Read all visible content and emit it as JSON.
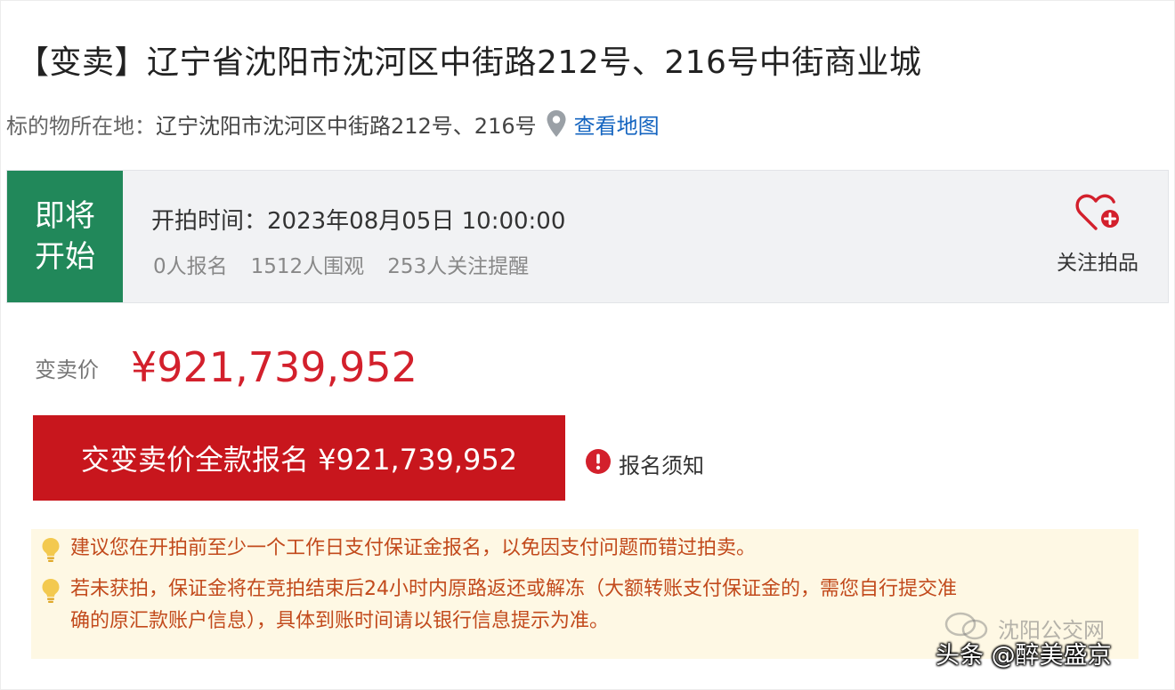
{
  "title": "【变卖】辽宁省沈阳市沈河区中街路212号、216号中街商业城",
  "location": {
    "label": "标的物所在地：",
    "value": "辽宁沈阳市沈河区中街路212号、216号",
    "icon": "map-pin-icon",
    "map_link": "查看地图"
  },
  "status": {
    "badge_line1": "即将",
    "badge_line2": "开始",
    "badge_color": "#21885a",
    "start_label": "开拍时间：",
    "start_time": "2023年08月05日 10:00:00",
    "signups": "0人报名",
    "views": "1512人围观",
    "followers": "253人关注提醒",
    "follow_icon": "heart-plus-icon",
    "follow_label": "关注拍品"
  },
  "price": {
    "label": "变卖价",
    "value": "¥921,739,952",
    "color": "#d3202c"
  },
  "signup_button": {
    "label": "交变卖价全款报名 ¥921,739,952",
    "color": "#c8161d"
  },
  "notice": {
    "icon": "exclamation-circle-icon",
    "label": "报名须知"
  },
  "tips": [
    {
      "icon": "lightbulb-icon",
      "text": "建议您在开拍前至少一个工作日支付保证金报名，以免因支付问题而错过拍卖。"
    },
    {
      "icon": "lightbulb-icon",
      "line1": "若未获拍，保证金将在竞拍结束后24小时内原路返还或解冻（大额转账支付保证金的，需您自行提交准",
      "line2": "确的原汇款账户信息），具体到账时间请以银行信息提示为准。"
    }
  ],
  "watermark": {
    "top": "沈阳公交网",
    "badge": "头条 @醉美盛京"
  }
}
